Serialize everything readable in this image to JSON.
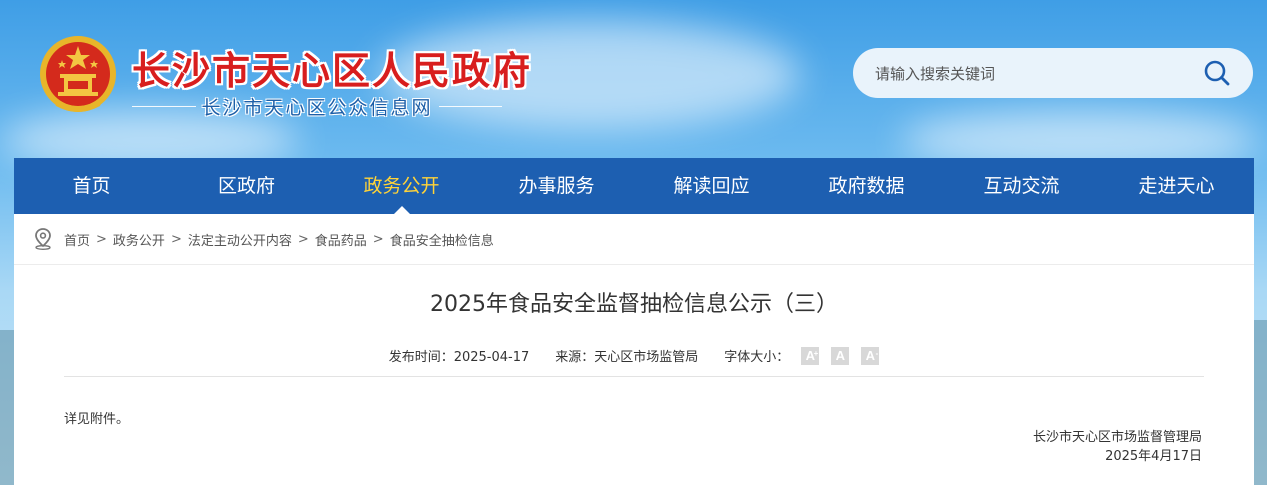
{
  "header": {
    "site_title": "长沙市天心区人民政府",
    "site_subtitle": "长沙市天心区公众信息网",
    "emblem_icon": "national-emblem-icon"
  },
  "search": {
    "placeholder": "请输入搜索关键词",
    "icon": "search-icon"
  },
  "nav": {
    "items": [
      {
        "label": "首页"
      },
      {
        "label": "区政府"
      },
      {
        "label": "政务公开"
      },
      {
        "label": "办事服务"
      },
      {
        "label": "解读回应"
      },
      {
        "label": "政府数据"
      },
      {
        "label": "互动交流"
      },
      {
        "label": "走进天心"
      }
    ],
    "active_index": 2,
    "active_color": "#ffd338",
    "background": "#1d5fb1"
  },
  "breadcrumb": {
    "icon": "location-pin-icon",
    "items": [
      "首页",
      "政务公开",
      "法定主动公开内容",
      "食品药品",
      "食品安全抽检信息"
    ],
    "separator": ">"
  },
  "article": {
    "title": "2025年食品安全监督抽检信息公示（三）",
    "publish_time": "发布时间：2025-04-17",
    "source": "来源：天心区市场监管局",
    "font_size_label": "字体大小：",
    "font_buttons": [
      "A",
      "A",
      "A"
    ],
    "body": "详见附件。",
    "signature_org": "长沙市天心区市场监督管理局",
    "signature_date": "2025年4月17日"
  }
}
